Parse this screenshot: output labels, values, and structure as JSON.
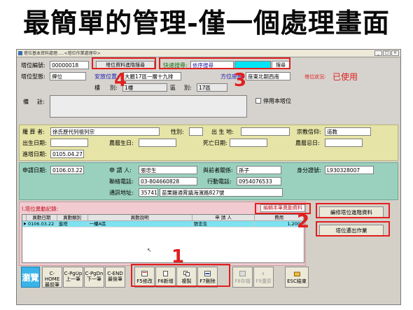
{
  "slide_title": "最簡單的管理-僅一個處理畫面",
  "window": {
    "title": "塔位基本資料處理.....<塔位作業處理中>"
  },
  "quick_search": {
    "adv_search_label": "塔位資料進階搜尋",
    "label": "快速搜尋:",
    "mode": "依序搜尋",
    "value": "",
    "button": "搜尋"
  },
  "top": {
    "tower_no_label": "塔位編號:",
    "tower_no": "00000018",
    "tower_type_label": "塔位型態:",
    "tower_type": "牌位",
    "location_label": "安放位置:",
    "location": "大廳17區一層十九排",
    "facing_label": "方位座朝:",
    "facing": "座東北朝西南",
    "seq_label": "樓",
    "seq_sub_label": "別:",
    "seq": "1樓",
    "area_label": "區",
    "area_sub_label": "別:",
    "area": "17區",
    "status_label": "塔位狀況:",
    "status": "已使用",
    "note_label": "備",
    "note_sub_label": "註:",
    "note": "",
    "disable_label": "停用本塔位"
  },
  "deceased": {
    "name_label": "羅 葬 者:",
    "name": "徐氏歷代列祖列宗",
    "gender_label": "性別:",
    "gender": "",
    "birthplace_label": "出 生 地:",
    "birthplace": "",
    "religion_label": "宗教信仰:",
    "religion": "道教",
    "birth_label": "出生日期:",
    "lunar_birth_label": "農曆生日:",
    "death_label": "死亡日期:",
    "lunar_death_label": "農曆忌日:",
    "enshrine_label": "進塔日期:",
    "enshrine_date": "0105.04.27"
  },
  "applicant": {
    "apply_date_label": "申請日期:",
    "apply_date": "0106.03.22",
    "applicant_label": "申 請 人:",
    "applicant": "張忠生",
    "relation_label": "與前者關係:",
    "relation": "孫子",
    "id_label": "身分證號:",
    "id": "L930328007",
    "phone_label": "聯絡電話:",
    "phone": "03-804660828",
    "mobile_label": "行動電話:",
    "mobile": "0954076533",
    "addr_label": "通訊地址:",
    "zip": "35741",
    "address": "苗栗縣通霄鎮海濱路827號"
  },
  "changes": {
    "title": "I.塔位異動記錄:",
    "edit_button": "編輯本筆異動資料",
    "columns": [
      "異動日期",
      "異動類別",
      "異動說明",
      "申 請 人",
      "費用"
    ],
    "rows": [
      [
        "0106.03.22",
        "進塔",
        "一樓A區",
        "張忠生",
        "1,200"
      ]
    ]
  },
  "side_buttons": {
    "edit_adv": "編修塔位進階資料",
    "exit": "塔位遷出作業"
  },
  "toolbar": {
    "browse": "瀏覽",
    "nav": [
      {
        "key": "C-HOME",
        "label": "最前筆"
      },
      {
        "key": "C-PgUp",
        "label": "上一筆"
      },
      {
        "key": "C-PgDn",
        "label": "下一筆"
      },
      {
        "key": "C-END",
        "label": "最後筆"
      }
    ],
    "actions": [
      "F5修改",
      "F6新增",
      "複製",
      "F7刪除",
      "F8存檔",
      "F9還原",
      "ESC結束"
    ]
  },
  "annotations": [
    "1",
    "2",
    "3",
    "4"
  ],
  "colors": {
    "accent_red": "#e02020",
    "panel_yellow": "#e6e4a6",
    "panel_green": "#9ad1be",
    "panel_pink": "#f1cbd0",
    "grid_select": "#7fe2f0"
  }
}
